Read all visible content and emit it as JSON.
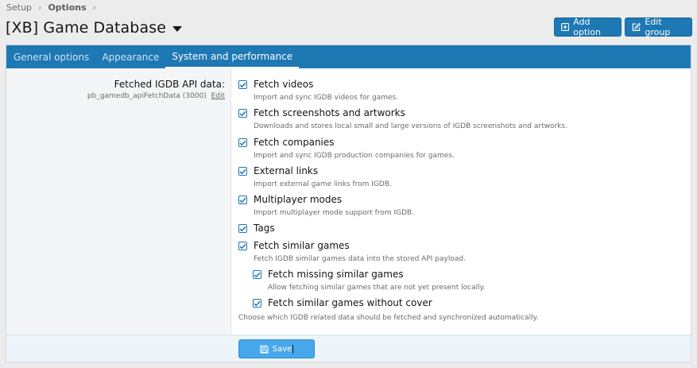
{
  "breadcrumb": {
    "items": [
      "Setup",
      "Options"
    ],
    "separator": "›"
  },
  "page": {
    "title": "[XB] Game Database"
  },
  "toolbar": {
    "add_option": "Add option",
    "edit_group": "Edit group"
  },
  "tabs": [
    {
      "label": "General options",
      "active": false
    },
    {
      "label": "Appearance",
      "active": false
    },
    {
      "label": "System and performance",
      "active": true
    }
  ],
  "setting": {
    "label": "Fetched IGDB API data:",
    "key_hint": "pb_gamedb_apiFetchData (3000)",
    "edit_link": "Edit",
    "options": [
      {
        "label": "Fetch videos",
        "desc": "Import and sync IGDB videos for games.",
        "checked": true
      },
      {
        "label": "Fetch screenshots and artworks",
        "desc": "Downloads and stores local small and large versions of IGDB screenshots and artworks.",
        "checked": true
      },
      {
        "label": "Fetch companies",
        "desc": "Import and sync IGDB production companies for games.",
        "checked": true
      },
      {
        "label": "External links",
        "desc": "Import external game links from IGDB.",
        "checked": true
      },
      {
        "label": "Multiplayer modes",
        "desc": "Import multiplayer mode support from IGDB.",
        "checked": true
      },
      {
        "label": "Tags",
        "desc": "",
        "checked": true
      },
      {
        "label": "Fetch similar games",
        "desc": "Fetch IGDB similar games data into the stored API payload.",
        "checked": true
      },
      {
        "label": "Fetch missing similar games",
        "desc": "Allow fetching similar games that are not yet present locally.",
        "checked": true
      },
      {
        "label": "Fetch similar games without cover",
        "desc": "",
        "checked": true
      }
    ],
    "explain": "Choose which IGDB related data should be fetched and synchronized automatically."
  },
  "submit": {
    "save_label": "Save"
  },
  "colors": {
    "accent": "#1e78b4",
    "save": "#47a7eb",
    "background": "#ececec"
  }
}
